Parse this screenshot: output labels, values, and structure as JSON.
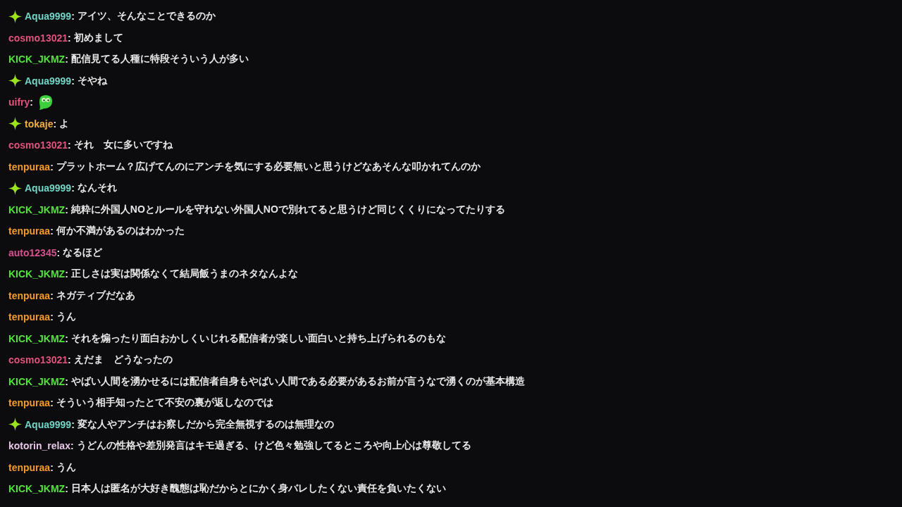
{
  "messages": [
    {
      "badge": true,
      "user": "Aqua9999",
      "color": "#6fd6c6",
      "sep": ":",
      "kind": "text",
      "text": "アイツ、そんなことできるのか"
    },
    {
      "badge": false,
      "user": "cosmo13021",
      "color": "#e2527c",
      "sep": ":",
      "kind": "text",
      "text": "初めまして"
    },
    {
      "badge": false,
      "user": "KICK_JKMZ",
      "color": "#52e33c",
      "sep": ":",
      "kind": "text",
      "text": "配信見てる人種に特段そういう人が多い"
    },
    {
      "badge": true,
      "user": "Aqua9999",
      "color": "#6fd6c6",
      "sep": ":",
      "kind": "text",
      "text": "そやね"
    },
    {
      "badge": false,
      "user": "uifry",
      "color": "#e2527c",
      "sep": ":",
      "kind": "emote"
    },
    {
      "badge": true,
      "user": "tokaje",
      "color": "#f0b040",
      "sep": ":",
      "kind": "text",
      "text": "よ"
    },
    {
      "badge": false,
      "user": "cosmo13021",
      "color": "#e2527c",
      "sep": ":",
      "kind": "text",
      "text": "それ　女に多いですね"
    },
    {
      "badge": false,
      "user": "tenpuraa",
      "color": "#f39a2a",
      "sep": ":",
      "kind": "text",
      "text": "プラットホーム？広げてんのにアンチを気にする必要無いと思うけどなあそんな叩かれてんのか"
    },
    {
      "badge": true,
      "user": "Aqua9999",
      "color": "#6fd6c6",
      "sep": ":",
      "kind": "text",
      "text": "なんそれ"
    },
    {
      "badge": false,
      "user": "KICK_JKMZ",
      "color": "#52e33c",
      "sep": ":",
      "kind": "text",
      "text": "純粋に外国人NOとルールを守れない外国人NOで別れてると思うけど同じくくりになってたりする"
    },
    {
      "badge": false,
      "user": "tenpuraa",
      "color": "#f39a2a",
      "sep": ":",
      "kind": "text",
      "text": "何か不満があるのはわかった"
    },
    {
      "badge": false,
      "user": "auto12345",
      "color": "#d9508f",
      "sep": ":",
      "kind": "text",
      "text": "なるほど"
    },
    {
      "badge": false,
      "user": "KICK_JKMZ",
      "color": "#52e33c",
      "sep": ":",
      "kind": "text",
      "text": "正しさは実は関係なくて結局飯うまのネタなんよな"
    },
    {
      "badge": false,
      "user": "tenpuraa",
      "color": "#f39a2a",
      "sep": ":",
      "kind": "text",
      "text": "ネガティブだなあ"
    },
    {
      "badge": false,
      "user": "tenpuraa",
      "color": "#f39a2a",
      "sep": ":",
      "kind": "text",
      "text": "うん"
    },
    {
      "badge": false,
      "user": "KICK_JKMZ",
      "color": "#52e33c",
      "sep": ":",
      "kind": "text",
      "text": "それを煽ったり面白おかしくいじれる配信者が楽しい面白いと持ち上げられるのもな"
    },
    {
      "badge": false,
      "user": "cosmo13021",
      "color": "#e2527c",
      "sep": ":",
      "kind": "text",
      "text": "えだま　どうなったの"
    },
    {
      "badge": false,
      "user": "KICK_JKMZ",
      "color": "#52e33c",
      "sep": ":",
      "kind": "text",
      "text": "やばい人間を湧かせるには配信者自身もやばい人間である必要があるお前が言うなで湧くのが基本構造"
    },
    {
      "badge": false,
      "user": "tenpuraa",
      "color": "#f39a2a",
      "sep": ":",
      "kind": "text",
      "text": "そういう相手知ったとて不安の裏が返しなのでは"
    },
    {
      "badge": true,
      "user": "Aqua9999",
      "color": "#6fd6c6",
      "sep": ":",
      "kind": "text",
      "text": "変な人やアンチはお察しだから完全無視するのは無理なの"
    },
    {
      "badge": false,
      "user": "kotorin_relax",
      "color": "#e8c6e6",
      "sep": ":",
      "kind": "text",
      "text": "うどんの性格や差別発言はキモ過ぎる、けど色々勉強してるところや向上心は尊敬してる"
    },
    {
      "badge": false,
      "user": "tenpuraa",
      "color": "#f39a2a",
      "sep": ":",
      "kind": "text",
      "text": "うん"
    },
    {
      "badge": false,
      "user": "KICK_JKMZ",
      "color": "#52e33c",
      "sep": ":",
      "kind": "text",
      "text": "日本人は匿名が大好き醜態は恥だからとにかく身バレしたくない責任を負いたくない"
    }
  ]
}
